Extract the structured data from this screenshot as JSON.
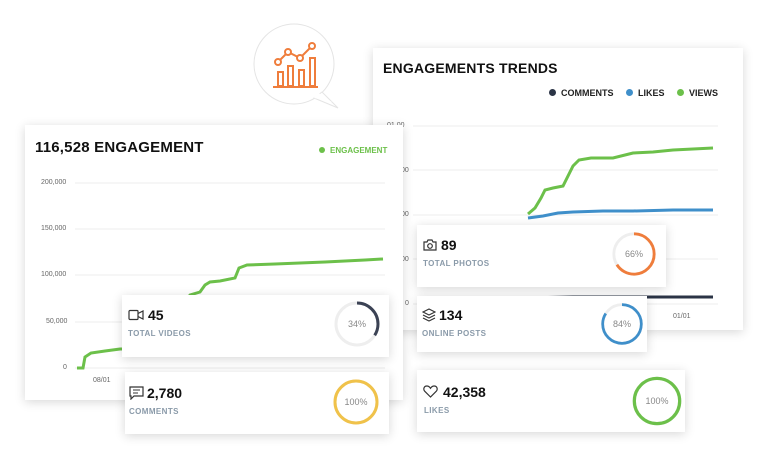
{
  "trends": {
    "title": "ENGAGEMENTS TRENDS",
    "legend": [
      {
        "label": "COMMENTS",
        "color": "#2b3446"
      },
      {
        "label": "LIKES",
        "color": "#3f8fca"
      },
      {
        "label": "VIEWS",
        "color": "#6cc04a"
      }
    ],
    "y_ticks": [
      "01,00",
      "00",
      "00",
      "00",
      "0"
    ],
    "x_ticks": [
      "01/01"
    ]
  },
  "engagement": {
    "title": "116,528 ENGAGEMENT",
    "legend_label": "ENGAGEMENT",
    "legend_color": "#6cc04a",
    "y_ticks": [
      "200,000",
      "150,000",
      "100,000",
      "50,000",
      "0"
    ],
    "x_ticks": [
      "08/01"
    ]
  },
  "stats": {
    "videos": {
      "value": "45",
      "label": "TOTAL VIDEOS",
      "percent_text": "34%",
      "percent": 0.34,
      "color": "#3b4254",
      "icon": "video-icon"
    },
    "comments": {
      "value": "2,780",
      "label": "COMMENTS",
      "percent_text": "100%",
      "percent": 1.0,
      "color": "#f0c24a",
      "icon": "comment-icon"
    },
    "photos": {
      "value": "89",
      "label": "TOTAL PHOTOS",
      "percent_text": "66%",
      "percent": 0.66,
      "color": "#ef7d3c",
      "icon": "camera-icon"
    },
    "posts": {
      "value": "134",
      "label": "ONLINE POSTS",
      "percent_text": "84%",
      "percent": 0.84,
      "color": "#3f8fca",
      "icon": "layers-icon"
    },
    "likes": {
      "value": "42,358",
      "label": "LIKES",
      "percent_text": "100%",
      "percent": 1.0,
      "color": "#6cc04a",
      "icon": "heart-icon"
    }
  },
  "badge": {
    "icon": "chart-growth-icon",
    "color": "#ef7d3c"
  }
}
